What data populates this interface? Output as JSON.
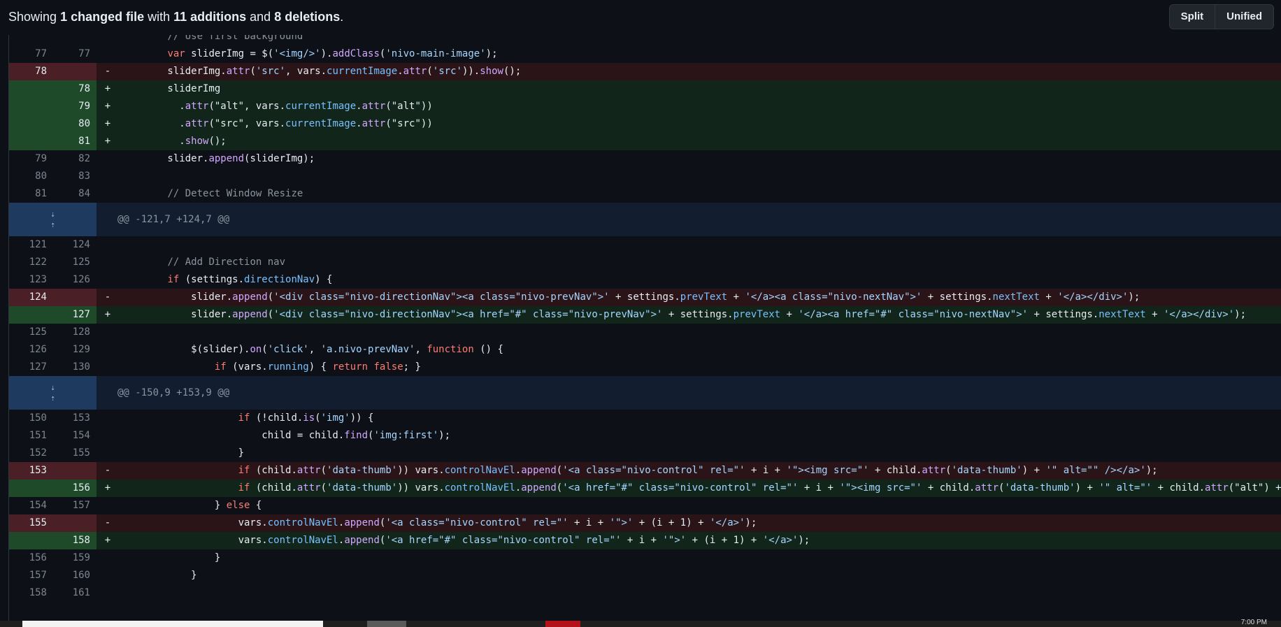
{
  "summary": {
    "prefix": "Showing ",
    "files": "1 changed file",
    "mid": " with ",
    "additions": "11 additions",
    "and": " and ",
    "deletions": "8 deletions",
    "end": "."
  },
  "view_toggle": {
    "split": "Split",
    "unified": "Unified"
  },
  "hunks": [
    {
      "type": "ctx",
      "old": "",
      "new": "",
      "code": "        // Use first background"
    },
    {
      "type": "ctx",
      "old": "77",
      "new": "77",
      "code": "        var sliderImg = $('<img/>').addClass('nivo-main-image');"
    },
    {
      "type": "del",
      "old": "78",
      "new": "",
      "code": "        sliderImg.attr('src', vars.currentImage.attr('src')).show();"
    },
    {
      "type": "add",
      "old": "",
      "new": "78",
      "code": "        sliderImg"
    },
    {
      "type": "add",
      "old": "",
      "new": "79",
      "code": "          .attr(\"alt\", vars.currentImage.attr(\"alt\"))"
    },
    {
      "type": "add",
      "old": "",
      "new": "80",
      "code": "          .attr(\"src\", vars.currentImage.attr(\"src\"))"
    },
    {
      "type": "add",
      "old": "",
      "new": "81",
      "code": "          .show();"
    },
    {
      "type": "ctx",
      "old": "79",
      "new": "82",
      "code": "        slider.append(sliderImg);"
    },
    {
      "type": "ctx",
      "old": "80",
      "new": "83",
      "code": ""
    },
    {
      "type": "ctx",
      "old": "81",
      "new": "84",
      "code": "        // Detect Window Resize"
    },
    {
      "type": "hunk",
      "code": "@@ -121,7 +124,7 @@"
    },
    {
      "type": "ctx",
      "old": "121",
      "new": "124",
      "code": ""
    },
    {
      "type": "ctx",
      "old": "122",
      "new": "125",
      "code": "        // Add Direction nav"
    },
    {
      "type": "ctx",
      "old": "123",
      "new": "126",
      "code": "        if (settings.directionNav) {"
    },
    {
      "type": "del",
      "old": "124",
      "new": "",
      "code": "            slider.append('<div class=\"nivo-directionNav\"><a class=\"nivo-prevNav\">' + settings.prevText + '</a><a class=\"nivo-nextNav\">' + settings.nextText + '</a></div>');"
    },
    {
      "type": "add",
      "old": "",
      "new": "127",
      "code": "            slider.append('<div class=\"nivo-directionNav\"><a href=\"#\" class=\"nivo-prevNav\">' + settings.prevText + '</a><a href=\"#\" class=\"nivo-nextNav\">' + settings.nextText + '</a></div>');"
    },
    {
      "type": "ctx",
      "old": "125",
      "new": "128",
      "code": ""
    },
    {
      "type": "ctx",
      "old": "126",
      "new": "129",
      "code": "            $(slider).on('click', 'a.nivo-prevNav', function () {"
    },
    {
      "type": "ctx",
      "old": "127",
      "new": "130",
      "code": "                if (vars.running) { return false; }"
    },
    {
      "type": "hunk",
      "code": "@@ -150,9 +153,9 @@"
    },
    {
      "type": "ctx",
      "old": "150",
      "new": "153",
      "code": "                    if (!child.is('img')) {"
    },
    {
      "type": "ctx",
      "old": "151",
      "new": "154",
      "code": "                        child = child.find('img:first');"
    },
    {
      "type": "ctx",
      "old": "152",
      "new": "155",
      "code": "                    }"
    },
    {
      "type": "del",
      "old": "153",
      "new": "",
      "code": "                    if (child.attr('data-thumb')) vars.controlNavEl.append('<a class=\"nivo-control\" rel=\"' + i + '\"><img src=\"' + child.attr('data-thumb') + '\" alt=\"\" /></a>');"
    },
    {
      "type": "add",
      "old": "",
      "new": "156",
      "code": "                    if (child.attr('data-thumb')) vars.controlNavEl.append('<a href=\"#\" class=\"nivo-control\" rel=\"' + i + '\"><img src=\"' + child.attr('data-thumb') + '\" alt=\"' + child.attr(\"alt\") + '\" /></a>');"
    },
    {
      "type": "ctx",
      "old": "154",
      "new": "157",
      "code": "                } else {"
    },
    {
      "type": "del",
      "old": "155",
      "new": "",
      "code": "                    vars.controlNavEl.append('<a class=\"nivo-control\" rel=\"' + i + '\">' + (i + 1) + '</a>');"
    },
    {
      "type": "add",
      "old": "",
      "new": "158",
      "code": "                    vars.controlNavEl.append('<a href=\"#\" class=\"nivo-control\" rel=\"' + i + '\">' + (i + 1) + '</a>');"
    },
    {
      "type": "ctx",
      "old": "156",
      "new": "159",
      "code": "                }"
    },
    {
      "type": "ctx",
      "old": "157",
      "new": "160",
      "code": "            }"
    },
    {
      "type": "ctx",
      "old": "158",
      "new": "161",
      "code": ""
    }
  ],
  "taskbar": {
    "clock": "7:00 PM"
  }
}
